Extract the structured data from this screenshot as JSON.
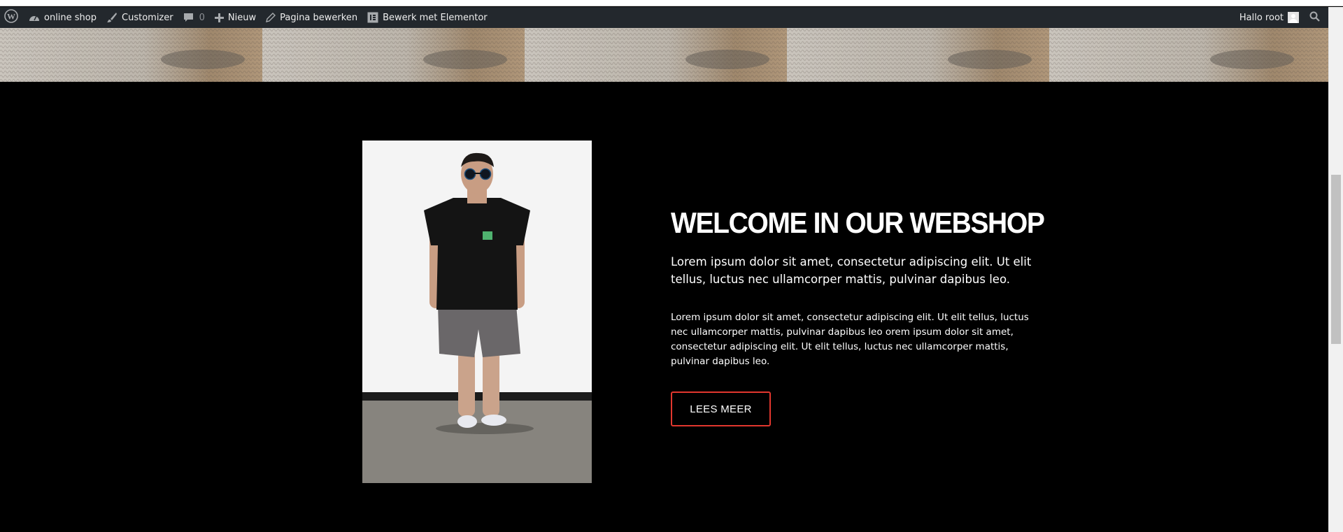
{
  "adminbar": {
    "site_name": "online shop",
    "customizer": "Customizer",
    "comments_count": "0",
    "new_label": "Nieuw",
    "edit_page": "Pagina bewerken",
    "elementor": "Bewerk met Elementor",
    "greeting": "Hallo root"
  },
  "hero": {
    "headline": "WELCOME IN OUR WEBSHOP",
    "lead": "Lorem ipsum dolor sit amet, consectetur adipiscing elit. Ut elit tellus, luctus nec ullamcorper mattis, pulvinar dapibus leo.",
    "body": "Lorem ipsum dolor sit amet, consectetur adipiscing elit. Ut elit tellus, luctus nec ullamcorper mattis, pulvinar dapibus leo orem ipsum dolor sit amet, consectetur adipiscing elit. Ut elit tellus, luctus nec ullamcorper mattis, pulvinar dapibus leo.",
    "button": "LEES MEER"
  },
  "colors": {
    "adminbar_bg": "#23282d",
    "page_bg": "#000000",
    "button_border": "#e2372e"
  },
  "icons": [
    "wordpress-logo-icon",
    "dashboard-icon",
    "paintbrush-icon",
    "comment-icon",
    "plus-icon",
    "pencil-icon",
    "elementor-icon",
    "avatar-icon",
    "search-icon"
  ]
}
